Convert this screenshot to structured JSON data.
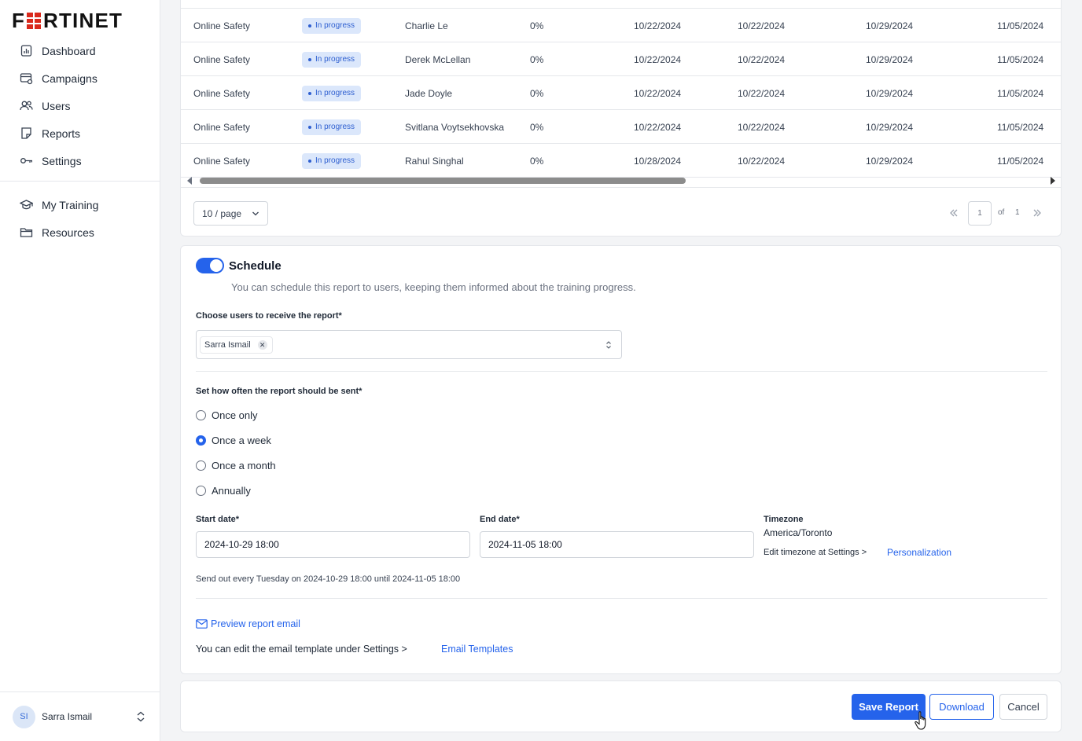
{
  "brand": {
    "logo_text": "FORTINET",
    "accent": "#2563eb",
    "logo_red": "#da291c"
  },
  "sidebar": {
    "items": [
      {
        "label": "Dashboard",
        "icon": "dashboard-icon"
      },
      {
        "label": "Campaigns",
        "icon": "campaigns-icon"
      },
      {
        "label": "Users",
        "icon": "users-icon"
      },
      {
        "label": "Reports",
        "icon": "reports-icon"
      },
      {
        "label": "Settings",
        "icon": "settings-key-icon"
      }
    ],
    "secondary_items": [
      {
        "label": "My Training",
        "icon": "graduation-cap-icon"
      },
      {
        "label": "Resources",
        "icon": "folder-icon"
      }
    ],
    "user": {
      "initials": "SI",
      "name": "Sarra Ismail"
    }
  },
  "table": {
    "rows": [
      {
        "course": "Online Safety",
        "status": "In progress",
        "user": "Charlie Le",
        "progress": "0%",
        "d1": "10/22/2024",
        "d2": "10/22/2024",
        "d3": "10/29/2024",
        "d4": "11/05/2024"
      },
      {
        "course": "Online Safety",
        "status": "In progress",
        "user": "Derek McLellan",
        "progress": "0%",
        "d1": "10/22/2024",
        "d2": "10/22/2024",
        "d3": "10/29/2024",
        "d4": "11/05/2024"
      },
      {
        "course": "Online Safety",
        "status": "In progress",
        "user": "Jade Doyle",
        "progress": "0%",
        "d1": "10/22/2024",
        "d2": "10/22/2024",
        "d3": "10/29/2024",
        "d4": "11/05/2024"
      },
      {
        "course": "Online Safety",
        "status": "In progress",
        "user": "Svitlana Voytsekhovska",
        "progress": "0%",
        "d1": "10/22/2024",
        "d2": "10/22/2024",
        "d3": "10/29/2024",
        "d4": "11/05/2024"
      },
      {
        "course": "Online Safety",
        "status": "In progress",
        "user": "Rahul Singhal",
        "progress": "0%",
        "d1": "10/28/2024",
        "d2": "10/22/2024",
        "d3": "10/29/2024",
        "d4": "11/05/2024"
      }
    ],
    "page_size": "10 / page",
    "current_page": "1",
    "of_label": "of",
    "total_pages": "1"
  },
  "schedule": {
    "enabled": true,
    "title": "Schedule",
    "description": "You can schedule this report to users, keeping them informed about the training progress.",
    "recipients_label": "Choose users to receive the report*",
    "recipients": [
      "Sarra Ismail"
    ],
    "frequency_label": "Set how often the report should be sent*",
    "frequency_options": [
      {
        "label": "Once only",
        "selected": false
      },
      {
        "label": "Once a week",
        "selected": true
      },
      {
        "label": "Once a month",
        "selected": false
      },
      {
        "label": "Annually",
        "selected": false
      }
    ],
    "start_label": "Start date*",
    "start_value": "2024-10-29 18:00",
    "end_label": "End date*",
    "end_value": "2024-11-05 18:00",
    "timezone_label": "Timezone",
    "timezone_value": "America/Toronto",
    "timezone_edit_text": "Edit timezone at Settings >",
    "timezone_link": "Personalization",
    "send_out_text": "Send out every Tuesday on 2024-10-29 18:00 until 2024-11-05 18:00",
    "preview_link": "Preview report email",
    "template_text": "You can edit the email template under Settings >",
    "template_link": "Email Templates"
  },
  "footer": {
    "save_label": "Save Report",
    "download_label": "Download",
    "cancel_label": "Cancel"
  }
}
